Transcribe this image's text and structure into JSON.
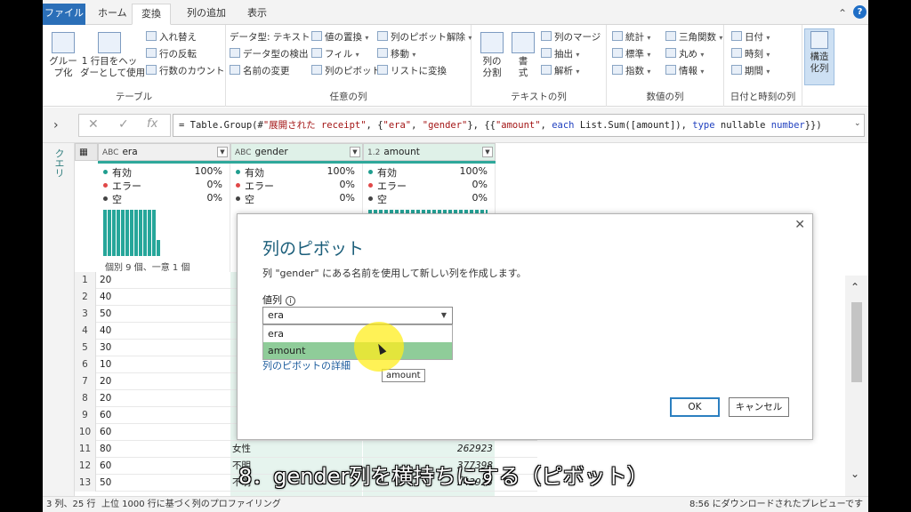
{
  "tabs": {
    "file": "ファイル",
    "home": "ホーム",
    "transform": "変換",
    "add_column": "列の追加",
    "view": "表示"
  },
  "ribbon": {
    "table": {
      "group_label": "テーブル",
      "group_btn": "グルー\nプ化",
      "first_row": "1 行目をヘッ\nダーとして使用",
      "transpose": "入れ替え",
      "reverse_rows": "行の反転",
      "count_rows": "行数のカウント"
    },
    "any_column": {
      "group_label": "任意の列",
      "data_type": "データ型: テキスト",
      "detect_type": "データ型の検出",
      "rename": "名前の変更",
      "replace_values": "値の置換",
      "fill": "フィル",
      "pivot_column": "列のピボット",
      "unpivot": "列のピボット解除",
      "move": "移動",
      "to_list": "リストに変換"
    },
    "text_column": {
      "group_label": "テキストの列",
      "split": "列の\n分割",
      "format": "書\n式",
      "merge": "列のマージ",
      "extract": "抽出",
      "parse": "解析"
    },
    "number_column": {
      "group_label": "数値の列",
      "statistics": "統計",
      "standard": "標準",
      "scientific": "指数",
      "trig": "三角関数",
      "rounding": "丸め",
      "info": "情報"
    },
    "datetime_column": {
      "group_label": "日付と時刻の列",
      "date": "日付",
      "time": "時刻",
      "duration": "期間"
    },
    "structured": {
      "label": "構造\n化列"
    }
  },
  "formula": {
    "prefix": "= Table.Group(#",
    "s1": "\"展開された receipt\"",
    "mid1": ", {",
    "s2": "\"era\"",
    "mid2": ", ",
    "s3": "\"gender\"",
    "mid3": "}, {{",
    "s4": "\"amount\"",
    "mid4": ", ",
    "kw1": "each",
    "mid5": " List.Sum([amount]), ",
    "kw2": "type",
    "mid6": " nullable ",
    "kw3": "number",
    "suffix": "}})"
  },
  "query_pane_label": "クエリ",
  "columns": [
    {
      "type": "ABC",
      "name": "era"
    },
    {
      "type": "ABC",
      "name": "gender"
    },
    {
      "type": "1.2",
      "name": "amount"
    }
  ],
  "profile": {
    "valid_label": "有効",
    "error_label": "エラー",
    "empty_label": "空",
    "valid": "100%",
    "error": "0%",
    "empty": "0%",
    "era_caption": "個別 9 個、一意 1 個",
    "colors": {
      "valid": "#1f9e8f",
      "error": "#e04848",
      "empty": "#444444"
    },
    "era_histogram": [
      1,
      1,
      1,
      1,
      1,
      1,
      1,
      1,
      1,
      1,
      1,
      1,
      0.35
    ]
  },
  "rows": [
    {
      "n": "1",
      "era": "20",
      "gender": "",
      "amount": ""
    },
    {
      "n": "2",
      "era": "40",
      "gender": "",
      "amount": ""
    },
    {
      "n": "3",
      "era": "50",
      "gender": "",
      "amount": ""
    },
    {
      "n": "4",
      "era": "40",
      "gender": "",
      "amount": ""
    },
    {
      "n": "5",
      "era": "30",
      "gender": "",
      "amount": ""
    },
    {
      "n": "6",
      "era": "10",
      "gender": "",
      "amount": ""
    },
    {
      "n": "7",
      "era": "20",
      "gender": "",
      "amount": ""
    },
    {
      "n": "8",
      "era": "20",
      "gender": "",
      "amount": ""
    },
    {
      "n": "9",
      "era": "60",
      "gender": "",
      "amount": ""
    },
    {
      "n": "10",
      "era": "60",
      "gender": "",
      "amount": ""
    },
    {
      "n": "11",
      "era": "80",
      "gender": "女性",
      "amount": "262923"
    },
    {
      "n": "12",
      "era": "60",
      "gender": "不明",
      "amount": "377398"
    },
    {
      "n": "13",
      "era": "50",
      "gender": "不明",
      "amount": "342923"
    }
  ],
  "status": {
    "left": "3 列、25 行",
    "profile": "上位 1000 行に基づく列のプロファイリング",
    "right": "8:56 にダウンロードされたプレビューです"
  },
  "dialog": {
    "title": "列のピボット",
    "description": "列 \"gender\" にある名前を使用して新しい列を作成します。",
    "values_label": "値列",
    "info_icon": "i",
    "selected": "era",
    "options": [
      "era",
      "amount"
    ],
    "advanced": "列のピボットの詳細",
    "tooltip": "amount",
    "ok": "OK",
    "cancel": "キャンセル",
    "close": "✕"
  },
  "subtitle": "8．gender列を横持ちにする（ピボット）",
  "accent_color": "#2b6fb8"
}
